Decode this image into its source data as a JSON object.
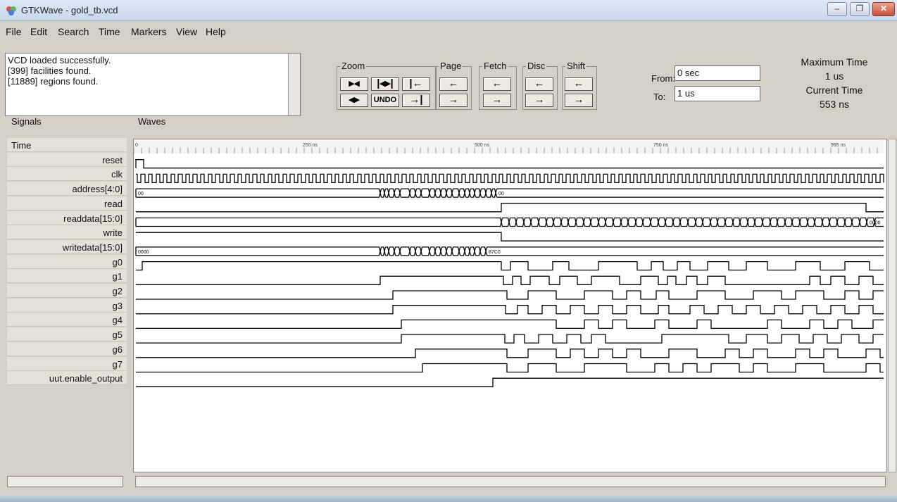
{
  "window": {
    "title": "GTKWave - gold_tb.vcd",
    "controls": [
      "–",
      "❐",
      "✕"
    ]
  },
  "menu": [
    "File",
    "Edit",
    "Search",
    "Time",
    "Markers",
    "View",
    "Help"
  ],
  "messages": [
    "VCD loaded successfully.",
    "[399] facilities found.",
    "[11889] regions found."
  ],
  "toolbar": {
    "zoom_label": "Zoom",
    "page_label": "Page",
    "fetch_label": "Fetch",
    "disc_label": "Disc",
    "shift_label": "Shift",
    "zoom_buttons": [
      "▸◂",
      "|◂▸|",
      "|←",
      "◂▸",
      "UNDO",
      "→|"
    ],
    "left_arrow": "←",
    "right_arrow": "→"
  },
  "range": {
    "from_label": "From:",
    "from_value": "0 sec",
    "to_label": "To:",
    "to_value": "1 us"
  },
  "time_info": {
    "max_label": "Maximum Time",
    "max_value": "1 us",
    "current_label": "Current Time",
    "current_value": "553 ns"
  },
  "panels": {
    "signals_label": "Signals",
    "waves_label": "Waves"
  },
  "signals": [
    "Time",
    "reset",
    "clk",
    "address[4:0]",
    "read",
    "readdata[15:0]",
    "write",
    "writedata[15:0]",
    "g0",
    "g1",
    "g2",
    "g3",
    "g4",
    "g5",
    "g6",
    "g7",
    "uut.enable_output"
  ],
  "ruler_ticks": [
    "0",
    "250 ns",
    "500 ns",
    "750 ns",
    "995 ns"
  ],
  "bus_values": {
    "address_start": "00",
    "address_end": "00",
    "writedata_start": "0000",
    "writedata_end": "87C0",
    "readdata_end": "0000"
  }
}
